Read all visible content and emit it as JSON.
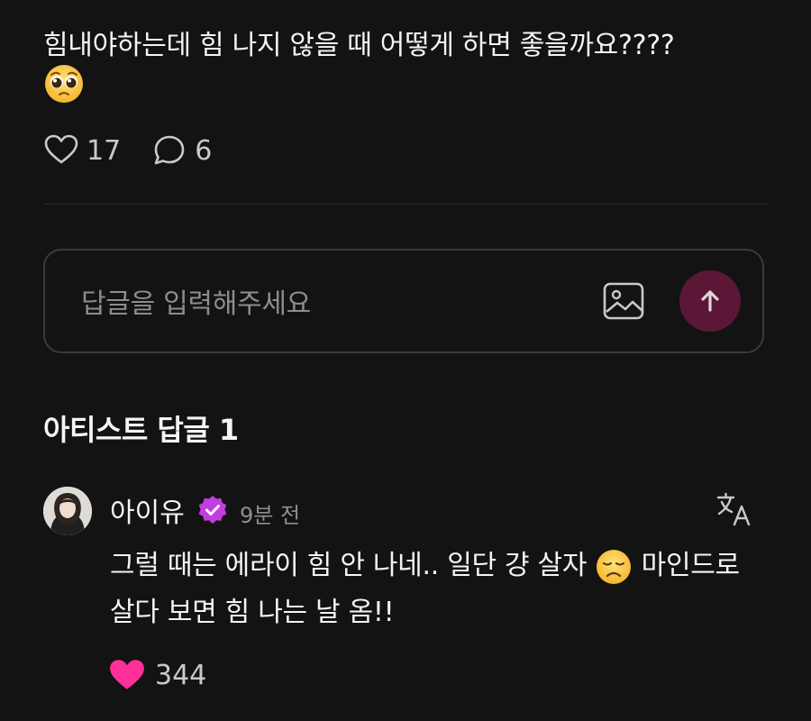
{
  "post": {
    "text": "힘내야하는데 힘 나지 않을 때 어떻게 하면 좋을까요????",
    "emoji": "pleading-face",
    "like_count": "17",
    "comment_count": "6"
  },
  "reply_input": {
    "placeholder": "답글을 입력해주세요"
  },
  "artist_replies": {
    "title": "아티스트 답글 1",
    "items": [
      {
        "username": "아이유",
        "verified": true,
        "time": "9분 전",
        "text_part1": "그럴 때는 에라이 힘 안 나네.. 일단 걍 살자 ",
        "emoji": "disappointed-face",
        "text_part2": " 마인드로 살다 보면 힘 나는 날 옴!!",
        "like_count": "344"
      }
    ]
  },
  "colors": {
    "background": "#131313",
    "accent_pink": "#ff2f9c",
    "send_button": "#5c1737",
    "verified_badge": "#c13ee0"
  }
}
